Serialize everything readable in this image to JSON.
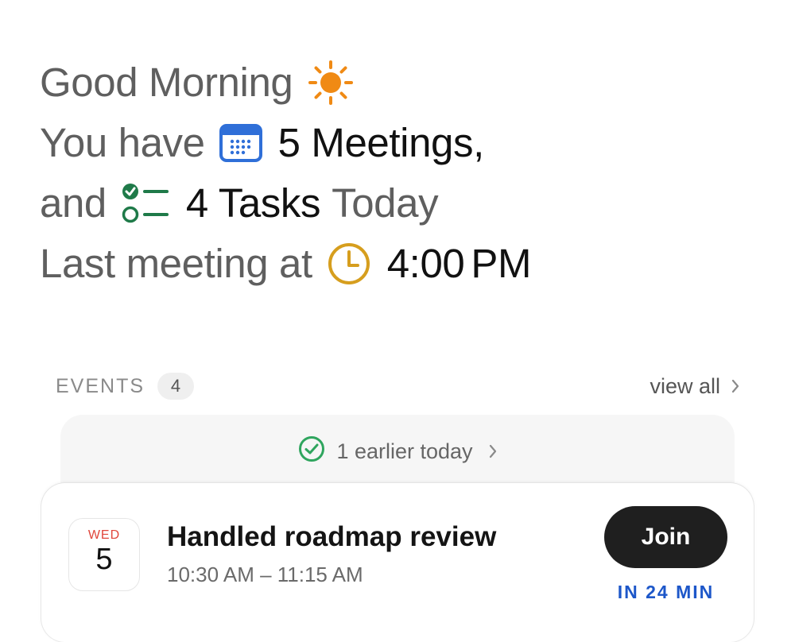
{
  "greeting": {
    "line1_text": "Good Morning",
    "line1_icon": "sun-icon",
    "line2_prefix": "You have",
    "meetings_icon": "calendar-icon",
    "meetings_text": "5 Meetings,",
    "line3_prefix": "and",
    "tasks_icon": "checklist-icon",
    "tasks_text": "4 Tasks",
    "line3_suffix": "Today",
    "line4_prefix": "Last meeting at",
    "clock_icon": "clock-icon",
    "last_time": "4:00",
    "last_period": "PM"
  },
  "events": {
    "label": "EVENTS",
    "count": "4",
    "view_all": "view all",
    "earlier": "1 earlier today",
    "item": {
      "weekday": "WED",
      "day": "5",
      "title": "Handled roadmap review",
      "time": "10:30 AM – 11:15 AM",
      "join_label": "Join",
      "countdown": "IN 24 MIN"
    }
  },
  "colors": {
    "sun": "#f08a14",
    "calendar": "#2f6fd8",
    "tasks": "#1f7a49",
    "clock": "#d69e1e",
    "check": "#2fa55e",
    "weekday": "#e0463b",
    "countdown": "#1d57c9",
    "join_bg": "#1f1f1f"
  }
}
